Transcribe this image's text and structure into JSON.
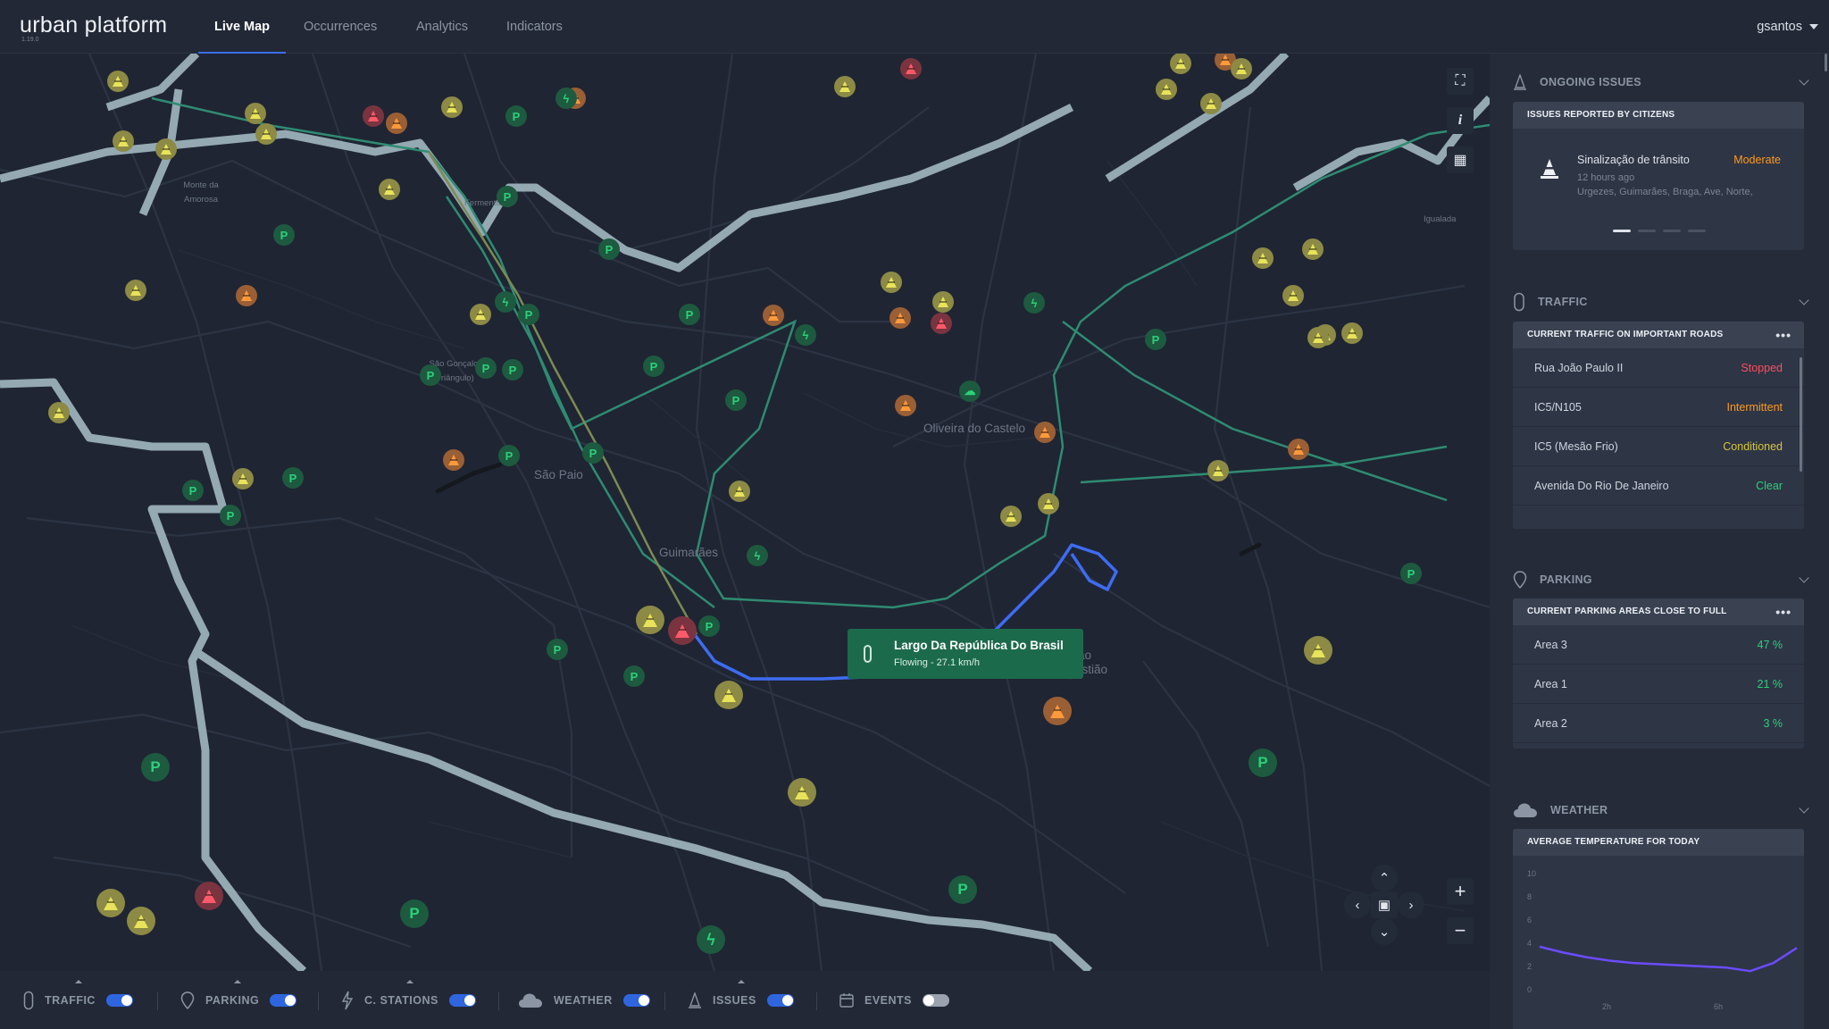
{
  "app": {
    "name": "urban platform",
    "version": "1.19.0",
    "user": "gsantos"
  },
  "nav": {
    "tabs": [
      "Live Map",
      "Occurrences",
      "Analytics",
      "Indicators"
    ],
    "active": "Live Map"
  },
  "map": {
    "labels": [
      "Oliveira do Castelo",
      "São Paio",
      "Guimarães",
      "São Sebastião",
      "São Gonçalo (Triângulo)",
      "Igualada",
      "Fermentões",
      "Monte da Amorosa"
    ],
    "popup": {
      "title": "Largo Da República Do Brasil",
      "subtitle": "Flowing - 27.1 km/h"
    },
    "controls": {
      "fullscreen": "⛶",
      "info": "i",
      "buildings": "▦",
      "zoom_in": "+",
      "zoom_out": "−"
    }
  },
  "layers": [
    {
      "label": "TRAFFIC",
      "icon": "traffic-light-icon",
      "enabled": true
    },
    {
      "label": "PARKING",
      "icon": "parking-pin-icon",
      "enabled": true
    },
    {
      "label": "C. STATIONS",
      "icon": "charging-bolt-icon",
      "enabled": true
    },
    {
      "label": "WEATHER",
      "icon": "cloud-icon",
      "enabled": true
    },
    {
      "label": "ISSUES",
      "icon": "cone-icon",
      "enabled": true
    },
    {
      "label": "EVENTS",
      "icon": "calendar-icon",
      "enabled": false
    }
  ],
  "panel": {
    "issues": {
      "title": "ONGOING ISSUES",
      "card_title": "ISSUES REPORTED BY CITIZENS",
      "item": {
        "name": "Sinalização de trânsito",
        "severity": "Moderate",
        "time": "12 hours ago",
        "location": "Urgezes, Guimarães, Braga, Ave, Norte,"
      },
      "pages": 4,
      "current_page": 1
    },
    "traffic": {
      "title": "TRAFFIC",
      "card_title": "CURRENT TRAFFIC ON IMPORTANT ROADS",
      "rows": [
        {
          "road": "Rua João Paulo II",
          "status": "Stopped",
          "color": "#ff4d5e"
        },
        {
          "road": "IC5/N105",
          "status": "Intermittent",
          "color": "#ff9a1f"
        },
        {
          "road": "IC5 (Mesão Frio)",
          "status": "Conditioned",
          "color": "#d6c53a"
        },
        {
          "road": "Avenida Do Rio De Janeiro",
          "status": "Clear",
          "color": "#2ecf7b"
        }
      ]
    },
    "parking": {
      "title": "PARKING",
      "card_title": "CURRENT PARKING AREAS CLOSE TO FULL",
      "rows": [
        {
          "area": "Area 3",
          "value": "47 %"
        },
        {
          "area": "Area 1",
          "value": "21 %"
        },
        {
          "area": "Area 2",
          "value": "3 %"
        }
      ]
    },
    "weather": {
      "title": "WEATHER",
      "card_title": "AVERAGE TEMPERATURE FOR TODAY",
      "y_ticks": [
        "10",
        "8",
        "6",
        "4",
        "2",
        "0"
      ],
      "x_ticks": [
        "2h",
        "6h"
      ]
    }
  },
  "chart_data": {
    "type": "line",
    "title": "AVERAGE TEMPERATURE FOR TODAY",
    "xlabel": "",
    "ylabel": "",
    "ylim": [
      0,
      10
    ],
    "x": [
      0,
      1,
      2,
      3,
      4,
      5,
      6,
      7,
      8,
      9,
      10,
      11
    ],
    "series": [
      {
        "values": [
          3.7,
          3.2,
          2.8,
          2.5,
          2.3,
          2.2,
          2.1,
          2.0,
          1.9,
          1.6,
          2.3,
          3.6
        ]
      }
    ],
    "color": "#6b4cff",
    "grid": false
  },
  "colors": {
    "accent": "#3c6df0",
    "popup_bg": "#1c6a4c",
    "route": "#3e6cf2"
  }
}
